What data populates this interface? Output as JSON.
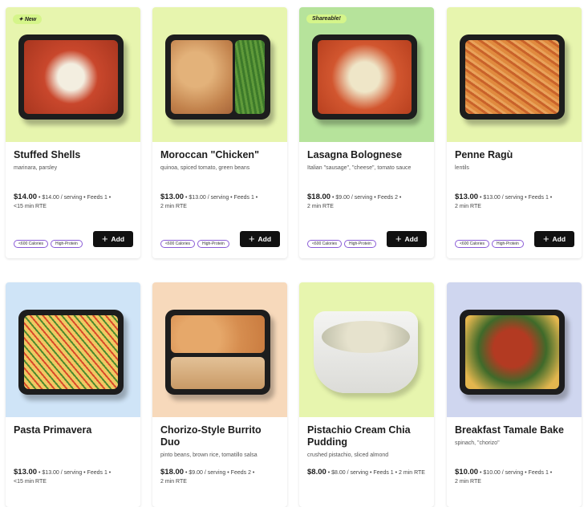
{
  "colors": {
    "add_button": "#111111",
    "tag_border": "#8a5cd6",
    "badge_bg": "#d5f58a"
  },
  "icons": {
    "add": "plus-icon",
    "new": "sparkle-icon"
  },
  "products": [
    {
      "name": "Stuffed Shells",
      "description": "marinara, parsley",
      "badge": "New",
      "price": "$14.00",
      "price_detail": "• $14.00 / serving • Feeds 1 •",
      "rte": "<15 min RTE",
      "tags": [
        "<600 Calories",
        "High-Protein"
      ],
      "add_label": "Add",
      "image_bg": "#e7f5ae"
    },
    {
      "name": "Moroccan \"Chicken\"",
      "description": "quinoa, spiced tomato, green beans",
      "badge": "",
      "price": "$13.00",
      "price_detail": "• $13.00 / serving • Feeds 1 •",
      "rte": "2 min RTE",
      "tags": [
        "<600 Calories",
        "High-Protein"
      ],
      "add_label": "Add",
      "image_bg": "#e7f5ae"
    },
    {
      "name": "Lasagna Bolognese",
      "description": "Italian \"sausage\", \"cheese\", tomato sauce",
      "badge": "Shareable!",
      "price": "$18.00",
      "price_detail": "• $9.00 / serving • Feeds 2 •",
      "rte": "2 min RTE",
      "tags": [
        "<600 Calories",
        "High-Protein"
      ],
      "add_label": "Add",
      "image_bg": "#b6e39b"
    },
    {
      "name": "Penne Ragù",
      "description": "lentils",
      "badge": "",
      "price": "$13.00",
      "price_detail": "• $13.00 / serving • Feeds 1 •",
      "rte": "2 min RTE",
      "tags": [
        "<600 Calories",
        "High-Protein"
      ],
      "add_label": "Add",
      "image_bg": "#e7f5ae"
    },
    {
      "name": "Pasta Primavera",
      "description": "",
      "badge": "",
      "price": "$13.00",
      "price_detail": "• $13.00 / serving • Feeds 1 •",
      "rte": "<15 min RTE",
      "image_bg": "#cfe4f7"
    },
    {
      "name": "Chorizo-Style Burrito Duo",
      "description": "pinto beans, brown rice, tomatillo salsa",
      "badge": "",
      "price": "$18.00",
      "price_detail": "• $9.00 / serving • Feeds 2 •",
      "rte": "2 min RTE",
      "image_bg": "#f7d9bb"
    },
    {
      "name": "Pistachio Cream Chia Pudding",
      "description": "crushed pistachio, sliced almond",
      "badge": "",
      "price": "$8.00",
      "price_detail": "• $8.00 / serving • Feeds 1 • 2 min RTE",
      "rte": "",
      "image_bg": "#e7f5ae"
    },
    {
      "name": "Breakfast Tamale Bake",
      "description": "spinach, \"chorizo\"",
      "badge": "",
      "price": "$10.00",
      "price_detail": "• $10.00 / serving • Feeds 1 •",
      "rte": "2 min RTE",
      "image_bg": "#cfd6ef"
    }
  ]
}
